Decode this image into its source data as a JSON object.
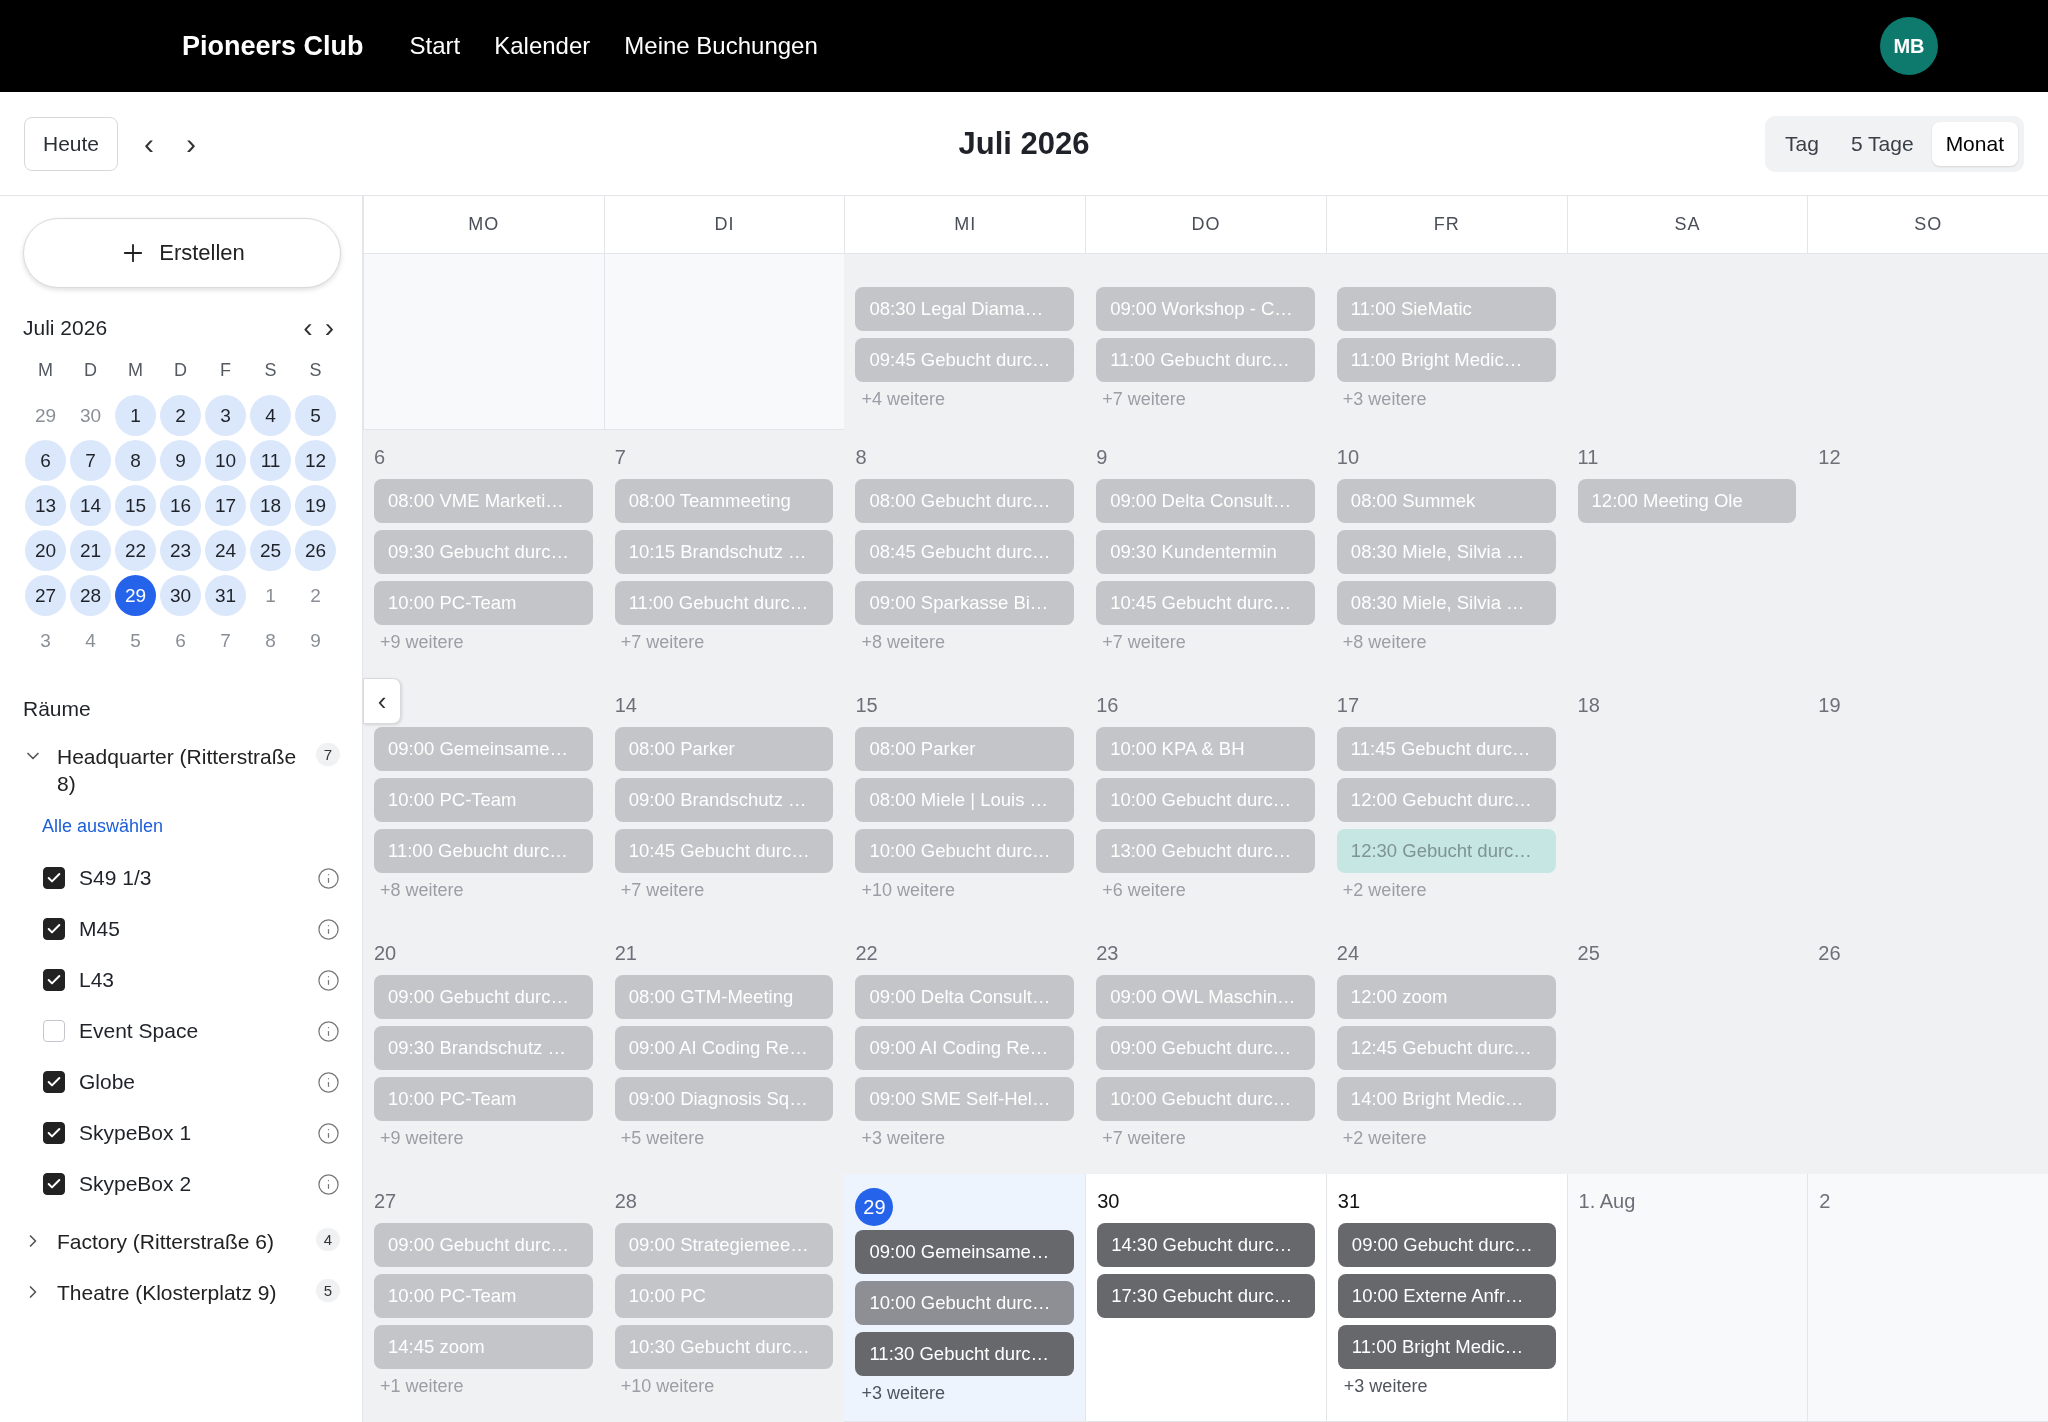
{
  "nav": {
    "brand": "Pioneers Club",
    "links": [
      "Start",
      "Kalender",
      "Meine Buchungen"
    ],
    "avatar": "MB"
  },
  "toolbar": {
    "today": "Heute",
    "prev": "‹",
    "next": "›",
    "title": "Juli 2026",
    "views": [
      {
        "label": "Tag",
        "selected": false
      },
      {
        "label": "5 Tage",
        "selected": false
      },
      {
        "label": "Monat",
        "selected": true
      }
    ]
  },
  "sidebar": {
    "create": "Erstellen",
    "mini_calendar": {
      "title": "Juli 2026",
      "prev": "‹",
      "next": "›",
      "weekdays": [
        "M",
        "D",
        "M",
        "D",
        "F",
        "S",
        "S"
      ],
      "days": [
        {
          "label": "29",
          "marked": false,
          "selected": false
        },
        {
          "label": "30",
          "marked": false,
          "selected": false
        },
        {
          "label": "1",
          "marked": true,
          "selected": false
        },
        {
          "label": "2",
          "marked": true,
          "selected": false
        },
        {
          "label": "3",
          "marked": true,
          "selected": false
        },
        {
          "label": "4",
          "marked": true,
          "selected": false
        },
        {
          "label": "5",
          "marked": true,
          "selected": false
        },
        {
          "label": "6",
          "marked": true,
          "selected": false
        },
        {
          "label": "7",
          "marked": true,
          "selected": false
        },
        {
          "label": "8",
          "marked": true,
          "selected": false
        },
        {
          "label": "9",
          "marked": true,
          "selected": false
        },
        {
          "label": "10",
          "marked": true,
          "selected": false
        },
        {
          "label": "11",
          "marked": true,
          "selected": false
        },
        {
          "label": "12",
          "marked": true,
          "selected": false
        },
        {
          "label": "13",
          "marked": true,
          "selected": false
        },
        {
          "label": "14",
          "marked": true,
          "selected": false
        },
        {
          "label": "15",
          "marked": true,
          "selected": false
        },
        {
          "label": "16",
          "marked": true,
          "selected": false
        },
        {
          "label": "17",
          "marked": true,
          "selected": false
        },
        {
          "label": "18",
          "marked": true,
          "selected": false
        },
        {
          "label": "19",
          "marked": true,
          "selected": false
        },
        {
          "label": "20",
          "marked": true,
          "selected": false
        },
        {
          "label": "21",
          "marked": true,
          "selected": false
        },
        {
          "label": "22",
          "marked": true,
          "selected": false
        },
        {
          "label": "23",
          "marked": true,
          "selected": false
        },
        {
          "label": "24",
          "marked": true,
          "selected": false
        },
        {
          "label": "25",
          "marked": true,
          "selected": false
        },
        {
          "label": "26",
          "marked": true,
          "selected": false
        },
        {
          "label": "27",
          "marked": true,
          "selected": false
        },
        {
          "label": "28",
          "marked": true,
          "selected": false
        },
        {
          "label": "29",
          "marked": true,
          "selected": true
        },
        {
          "label": "30",
          "marked": true,
          "selected": false
        },
        {
          "label": "31",
          "marked": true,
          "selected": false
        },
        {
          "label": "1",
          "marked": false,
          "selected": false
        },
        {
          "label": "2",
          "marked": false,
          "selected": false
        },
        {
          "label": "3",
          "marked": false,
          "selected": false
        },
        {
          "label": "4",
          "marked": false,
          "selected": false
        },
        {
          "label": "5",
          "marked": false,
          "selected": false
        },
        {
          "label": "6",
          "marked": false,
          "selected": false
        },
        {
          "label": "7",
          "marked": false,
          "selected": false
        },
        {
          "label": "8",
          "marked": false,
          "selected": false
        },
        {
          "label": "9",
          "marked": false,
          "selected": false
        }
      ]
    },
    "rooms_title": "Räume",
    "groups": [
      {
        "label": "Headquarter (Ritterstraße 8)",
        "count": "7",
        "expanded": true,
        "select_all": "Alle auswählen",
        "rooms": [
          {
            "label": "S49 1/3",
            "checked": true
          },
          {
            "label": "M45",
            "checked": true
          },
          {
            "label": "L43",
            "checked": true
          },
          {
            "label": "Event Space",
            "checked": false
          },
          {
            "label": "Globe",
            "checked": true
          },
          {
            "label": "SkypeBox 1",
            "checked": true
          },
          {
            "label": "SkypeBox 2",
            "checked": true
          }
        ]
      },
      {
        "label": "Factory (Ritterstraße 6)",
        "count": "4",
        "expanded": false
      },
      {
        "label": "Theatre (Klosterplatz 9)",
        "count": "5",
        "expanded": false
      }
    ]
  },
  "collapse": "‹",
  "calendar": {
    "weekdays": [
      "MO",
      "DI",
      "MI",
      "DO",
      "FR",
      "SA",
      "SO"
    ],
    "weeks": [
      [
        {
          "kind": "outside"
        },
        {
          "kind": "outside"
        },
        {
          "kind": "past",
          "events": [
            {
              "text": "08:30 Legal Diama…",
              "kind": "past"
            },
            {
              "text": "09:45 Gebucht durc…",
              "kind": "past"
            }
          ],
          "more": "+4 weitere"
        },
        {
          "kind": "past",
          "events": [
            {
              "text": "09:00 Workshop - C…",
              "kind": "past"
            },
            {
              "text": "11:00 Gebucht durc…",
              "kind": "past"
            }
          ],
          "more": "+7 weitere"
        },
        {
          "kind": "past",
          "events": [
            {
              "text": "11:00 SieMatic",
              "kind": "past"
            },
            {
              "text": "11:00 Bright Medic…",
              "kind": "past"
            }
          ],
          "more": "+3 weitere"
        },
        {
          "kind": "past"
        },
        {
          "kind": "past"
        }
      ],
      [
        {
          "label": "6",
          "kind": "past",
          "events": [
            {
              "text": "08:00 VME Marketi…",
              "kind": "past"
            },
            {
              "text": "09:30 Gebucht durc…",
              "kind": "past"
            },
            {
              "text": "10:00 PC-Team",
              "kind": "past"
            }
          ],
          "more": "+9 weitere"
        },
        {
          "label": "7",
          "kind": "past",
          "events": [
            {
              "text": "08:00 Teammeeting",
              "kind": "past"
            },
            {
              "text": "10:15 Brandschutz …",
              "kind": "past"
            },
            {
              "text": "11:00 Gebucht durc…",
              "kind": "past"
            }
          ],
          "more": "+7 weitere"
        },
        {
          "label": "8",
          "kind": "past",
          "events": [
            {
              "text": "08:00 Gebucht durc…",
              "kind": "past"
            },
            {
              "text": "08:45 Gebucht durc…",
              "kind": "past"
            },
            {
              "text": "09:00 Sparkasse Bi…",
              "kind": "past"
            }
          ],
          "more": "+8 weitere"
        },
        {
          "label": "9",
          "kind": "past",
          "events": [
            {
              "text": "09:00 Delta Consult…",
              "kind": "past"
            },
            {
              "text": "09:30 Kundentermin",
              "kind": "past"
            },
            {
              "text": "10:45 Gebucht durc…",
              "kind": "past"
            }
          ],
          "more": "+7 weitere"
        },
        {
          "label": "10",
          "kind": "past",
          "events": [
            {
              "text": "08:00 Summek",
              "kind": "past"
            },
            {
              "text": "08:30 Miele, Silvia …",
              "kind": "past"
            },
            {
              "text": "08:30 Miele, Silvia …",
              "kind": "past"
            }
          ],
          "more": "+8 weitere"
        },
        {
          "label": "11",
          "kind": "past",
          "events": [
            {
              "text": "12:00 Meeting Ole",
              "kind": "past"
            }
          ]
        },
        {
          "label": "12",
          "kind": "past"
        }
      ],
      [
        {
          "kind": "past",
          "events": [
            {
              "text": "09:00 Gemeinsame…",
              "kind": "past"
            },
            {
              "text": "10:00 PC-Team",
              "kind": "past"
            },
            {
              "text": "11:00 Gebucht durc…",
              "kind": "past"
            }
          ],
          "more": "+8 weitere"
        },
        {
          "label": "14",
          "kind": "past",
          "events": [
            {
              "text": "08:00 Parker",
              "kind": "past"
            },
            {
              "text": "09:00 Brandschutz …",
              "kind": "past"
            },
            {
              "text": "10:45 Gebucht durc…",
              "kind": "past"
            }
          ],
          "more": "+7 weitere"
        },
        {
          "label": "15",
          "kind": "past",
          "events": [
            {
              "text": "08:00 Parker",
              "kind": "past"
            },
            {
              "text": "08:00 Miele | Louis …",
              "kind": "past"
            },
            {
              "text": "10:00 Gebucht durc…",
              "kind": "past"
            }
          ],
          "more": "+10 weitere"
        },
        {
          "label": "16",
          "kind": "past",
          "events": [
            {
              "text": "10:00 KPA & BH",
              "kind": "past"
            },
            {
              "text": "10:00 Gebucht durc…",
              "kind": "past"
            },
            {
              "text": "13:00 Gebucht durc…",
              "kind": "past"
            }
          ],
          "more": "+6 weitere"
        },
        {
          "label": "17",
          "kind": "past",
          "events": [
            {
              "text": "11:45 Gebucht durc…",
              "kind": "past"
            },
            {
              "text": "12:00 Gebucht durc…",
              "kind": "past"
            },
            {
              "text": "12:30 Gebucht durc…",
              "kind": "tentative"
            }
          ],
          "more": "+2 weitere"
        },
        {
          "label": "18",
          "kind": "past"
        },
        {
          "label": "19",
          "kind": "past"
        }
      ],
      [
        {
          "label": "20",
          "kind": "past",
          "events": [
            {
              "text": "09:00 Gebucht durc…",
              "kind": "past"
            },
            {
              "text": "09:30 Brandschutz …",
              "kind": "past"
            },
            {
              "text": "10:00 PC-Team",
              "kind": "past"
            }
          ],
          "more": "+9 weitere"
        },
        {
          "label": "21",
          "kind": "past",
          "events": [
            {
              "text": "08:00 GTM-Meeting",
              "kind": "past"
            },
            {
              "text": "09:00 AI Coding Re…",
              "kind": "past"
            },
            {
              "text": "09:00 Diagnosis Sq…",
              "kind": "past"
            }
          ],
          "more": "+5 weitere"
        },
        {
          "label": "22",
          "kind": "past",
          "events": [
            {
              "text": "09:00 Delta Consult…",
              "kind": "past"
            },
            {
              "text": "09:00 AI Coding Re…",
              "kind": "past"
            },
            {
              "text": "09:00 SME Self-Hel…",
              "kind": "past"
            }
          ],
          "more": "+3 weitere"
        },
        {
          "label": "23",
          "kind": "past",
          "events": [
            {
              "text": "09:00 OWL Maschin…",
              "kind": "past"
            },
            {
              "text": "09:00 Gebucht durc…",
              "kind": "past"
            },
            {
              "text": "10:00 Gebucht durc…",
              "kind": "past"
            }
          ],
          "more": "+7 weitere"
        },
        {
          "label": "24",
          "kind": "past",
          "events": [
            {
              "text": "12:00 zoom",
              "kind": "past"
            },
            {
              "text": "12:45 Gebucht durc…",
              "kind": "past"
            },
            {
              "text": "14:00 Bright Medic…",
              "kind": "past"
            }
          ],
          "more": "+2 weitere"
        },
        {
          "label": "25",
          "kind": "past"
        },
        {
          "label": "26",
          "kind": "past"
        }
      ],
      [
        {
          "label": "27",
          "kind": "past",
          "events": [
            {
              "text": "09:00 Gebucht durc…",
              "kind": "past"
            },
            {
              "text": "10:00 PC-Team",
              "kind": "past"
            },
            {
              "text": "14:45 zoom",
              "kind": "past"
            }
          ],
          "more": "+1 weitere"
        },
        {
          "label": "28",
          "kind": "past",
          "events": [
            {
              "text": "09:00 Strategiemee…",
              "kind": "past"
            },
            {
              "text": "10:00 PC",
              "kind": "past"
            },
            {
              "text": "10:30 Gebucht durc…",
              "kind": "past"
            }
          ],
          "more": "+10 weitere"
        },
        {
          "label": "29",
          "kind": "today",
          "events": [
            {
              "text": "09:00 Gemeinsame…",
              "kind": "upcoming"
            },
            {
              "text": "10:00 Gebucht durc…",
              "kind": "running"
            },
            {
              "text": "11:30 Gebucht durc…",
              "kind": "upcoming"
            }
          ],
          "more": "+3 weitere"
        },
        {
          "label": "30",
          "kind": "future",
          "events": [
            {
              "text": "14:30 Gebucht durc…",
              "kind": "upcoming"
            },
            {
              "text": "17:30 Gebucht durc…",
              "kind": "upcoming"
            }
          ]
        },
        {
          "label": "31",
          "kind": "future",
          "events": [
            {
              "text": "09:00 Gebucht durc…",
              "kind": "upcoming"
            },
            {
              "text": "10:00 Externe Anfr…",
              "kind": "upcoming"
            },
            {
              "text": "11:00 Bright Medic…",
              "kind": "upcoming"
            }
          ],
          "more": "+3 weitere"
        },
        {
          "label": "1. Aug",
          "kind": "outside"
        },
        {
          "label": "2",
          "kind": "outside"
        }
      ]
    ]
  }
}
